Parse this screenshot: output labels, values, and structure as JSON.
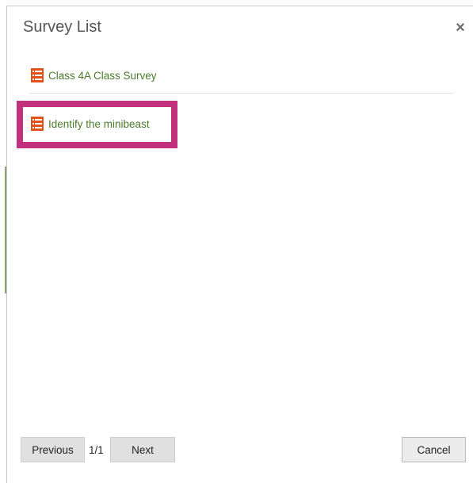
{
  "dialog": {
    "title": "Survey List",
    "close_label": "×"
  },
  "surveys": [
    {
      "label": "Class 4A Class Survey",
      "icon": "survey-list-icon"
    },
    {
      "label": "Identify the minibeast",
      "icon": "survey-list-icon"
    }
  ],
  "pagination": {
    "previous_label": "Previous",
    "page_indicator": "1/1",
    "next_label": "Next"
  },
  "footer": {
    "cancel_label": "Cancel"
  },
  "colors": {
    "link_green": "#4a7a2a",
    "icon_orange": "#e0541b",
    "highlight_magenta": "#c2307e"
  }
}
